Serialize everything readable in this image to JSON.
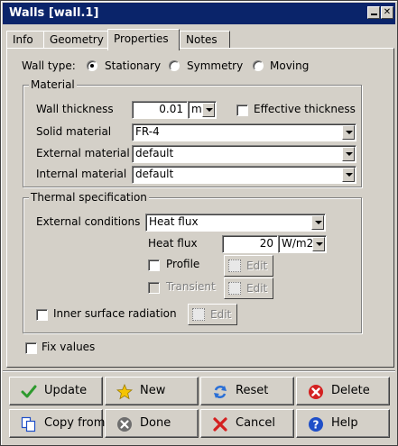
{
  "window": {
    "title": "Walls [wall.1]"
  },
  "tabs": [
    {
      "label": "Info"
    },
    {
      "label": "Geometry"
    },
    {
      "label": "Properties"
    },
    {
      "label": "Notes"
    }
  ],
  "wall_type": {
    "label": "Wall type:",
    "options": [
      "Stationary",
      "Symmetry",
      "Moving"
    ],
    "selected": "Stationary"
  },
  "material": {
    "group_title": "Material",
    "thickness_label": "Wall thickness",
    "thickness_value": "0.01",
    "thickness_unit": "m",
    "effective_thickness_label": "Effective thickness",
    "effective_thickness_checked": false,
    "solid_label": "Solid material",
    "solid_value": "FR-4",
    "external_label": "External material",
    "external_value": "default",
    "internal_label": "Internal material",
    "internal_value": "default"
  },
  "thermal": {
    "group_title": "Thermal specification",
    "ext_cond_label": "External conditions",
    "ext_cond_value": "Heat flux",
    "heat_flux_label": "Heat flux",
    "heat_flux_value": "20",
    "heat_flux_unit": "W/m2",
    "profile_label": "Profile",
    "profile_checked": false,
    "transient_label": "Transient",
    "transient_checked": false,
    "edit_label": "Edit",
    "inner_radiation_label": "Inner surface radiation",
    "inner_radiation_checked": false
  },
  "fix_values": {
    "label": "Fix values",
    "checked": false
  },
  "buttons": {
    "update": "Update",
    "new": "New",
    "reset": "Reset",
    "delete": "Delete",
    "copy_from": "Copy from",
    "done": "Done",
    "cancel": "Cancel",
    "help": "Help"
  },
  "colors": {
    "title_bar": "#0a246a",
    "face": "#d4d0c8",
    "check_green": "#2e9a2e",
    "star_yellow": "#f5c400",
    "reset_blue": "#2a6fd6",
    "delete_red": "#d42020",
    "help_blue": "#1f4fc8"
  }
}
